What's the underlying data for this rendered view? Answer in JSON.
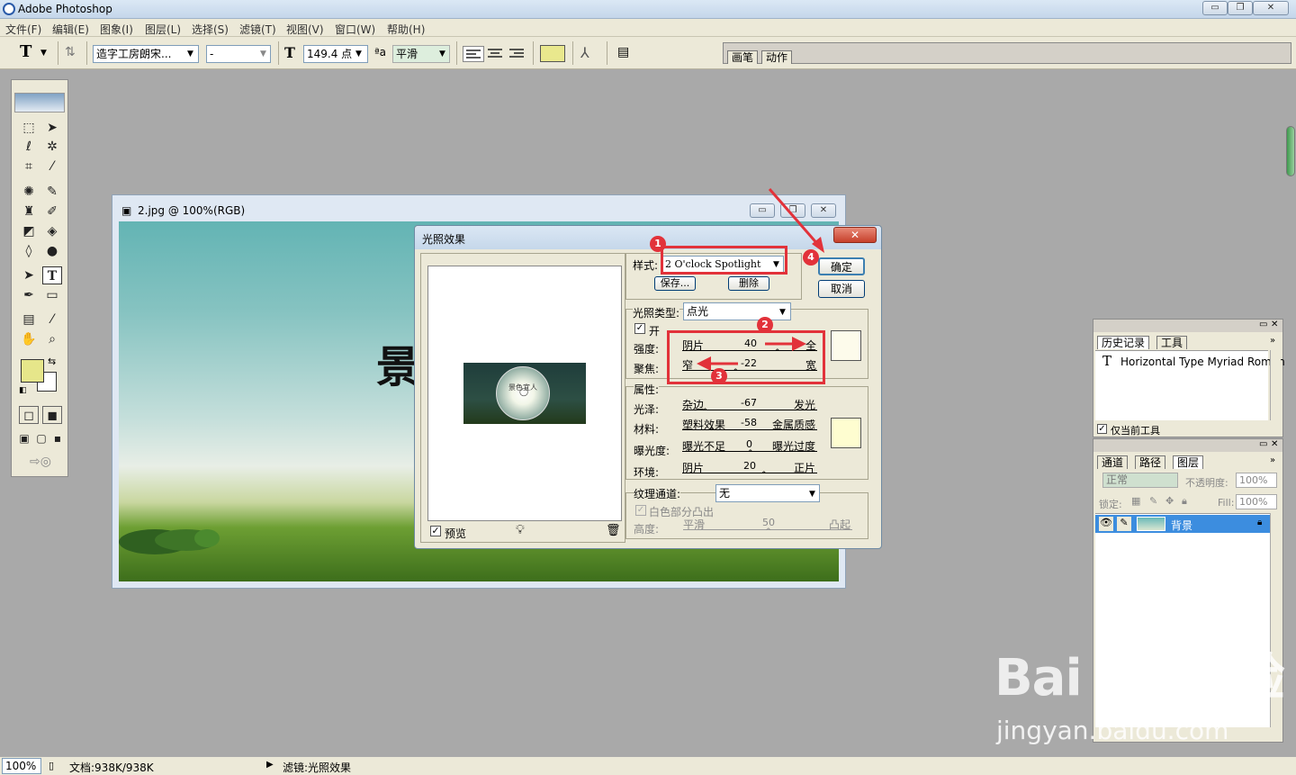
{
  "app": {
    "title": "Adobe Photoshop"
  },
  "window_controls": {
    "minimize": "▭",
    "maximize": "❐",
    "close": "✕"
  },
  "menu": [
    "文件(F)",
    "编辑(E)",
    "图象(I)",
    "图层(L)",
    "选择(S)",
    "滤镜(T)",
    "视图(V)",
    "窗口(W)",
    "帮助(H)"
  ],
  "options_bar": {
    "font_family": "造字工房朗宋...",
    "font_style": "-",
    "font_size": "149.4 点",
    "aa_label": "ªa",
    "antialias": "平滑",
    "swatch_color": "#e9e88d"
  },
  "palette_tabs": [
    "画笔",
    "动作"
  ],
  "document": {
    "title": "2.jpg @ 100%(RGB)",
    "canvas_text": "景"
  },
  "dialog": {
    "title": "光照效果",
    "close": "✕",
    "style_label": "样式:",
    "style_value": "2 O'clock Spotlight",
    "save": "保存...",
    "delete": "删除",
    "ok": "确定",
    "cancel": "取消",
    "preview_text": "景色宜人",
    "light_type_label": "光照类型:",
    "light_type_value": "点光",
    "on_label": "开",
    "intensity": {
      "label": "强度:",
      "left": "阴片",
      "value": "40",
      "right": "全"
    },
    "focus": {
      "label": "聚焦:",
      "left": "窄",
      "value": "-22",
      "right": "宽"
    },
    "properties_label": "属性:",
    "gloss": {
      "label": "光泽:",
      "left": "杂边",
      "value": "-67",
      "right": "发光"
    },
    "material": {
      "label": "材料:",
      "left": "塑料效果",
      "value": "-58",
      "right": "金属质感"
    },
    "exposure": {
      "label": "曝光度:",
      "left": "曝光不足",
      "value": "0",
      "right": "曝光过度"
    },
    "ambience": {
      "label": "环境:",
      "left": "阴片",
      "value": "20",
      "right": "正片"
    },
    "texture_label": "纹理通道:",
    "texture_value": "无",
    "white_high": "白色部分凸出",
    "height": {
      "label": "高度:",
      "left": "平滑",
      "value": "50",
      "right": "凸起"
    },
    "preview_label": "预览",
    "light_color": "#fdfbeb",
    "property_color": "#fefdd0"
  },
  "annotations": [
    "1",
    "2",
    "3",
    "4"
  ],
  "history_panel": {
    "tabs": [
      "历史记录",
      "工具"
    ],
    "item": "Horizontal Type Myriad Roman",
    "footer": "仅当前工具"
  },
  "layers_panel": {
    "tabs": [
      "通道",
      "路径",
      "图层"
    ],
    "blend_mode": "正常",
    "opacity_label": "不透明度:",
    "opacity": "100%",
    "lock_label": "锁定:",
    "fill_label": "Fill:",
    "fill": "100%",
    "layer_name": "背景"
  },
  "status": {
    "zoom": "100%",
    "doc_size": "文档:938K/938K",
    "info": "滤镜:光照效果"
  },
  "watermark": {
    "logo": "Bai du 经验",
    "url": "jingyan.baidu.com"
  }
}
